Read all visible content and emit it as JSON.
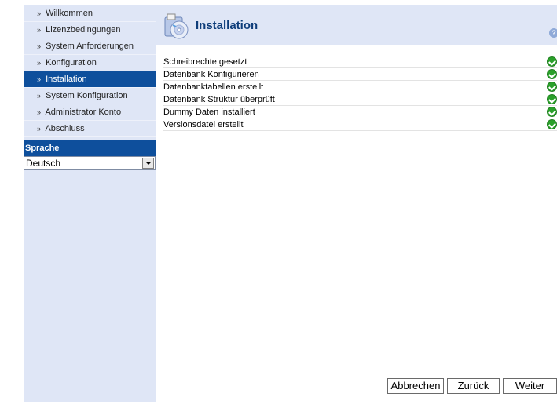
{
  "sidebar": {
    "items": [
      {
        "label": "Willkommen"
      },
      {
        "label": "Lizenzbedingungen"
      },
      {
        "label": "System Anforderungen"
      },
      {
        "label": "Konfiguration"
      },
      {
        "label": "Installation"
      },
      {
        "label": "System Konfiguration"
      },
      {
        "label": "Administrator Konto"
      },
      {
        "label": "Abschluss"
      }
    ],
    "arrow": "»",
    "language_header": "Sprache",
    "language_selected": "Deutsch"
  },
  "header": {
    "title": "Installation",
    "help": "?"
  },
  "steps": [
    {
      "label": "Schreibrechte gesetzt",
      "status": "ok"
    },
    {
      "label": "Datenbank Konfigurieren",
      "status": "ok"
    },
    {
      "label": "Datenbanktabellen erstellt",
      "status": "ok"
    },
    {
      "label": "Datenbank Struktur überprüft",
      "status": "ok"
    },
    {
      "label": "Dummy Daten installiert",
      "status": "ok"
    },
    {
      "label": "Versionsdatei erstellt",
      "status": "ok"
    }
  ],
  "buttons": {
    "cancel": "Abbrechen",
    "back": "Zurück",
    "next": "Weiter"
  },
  "colors": {
    "accent": "#0e4f9c",
    "sidebar_bg": "#dfe6f6",
    "ok_green": "#2aa02a"
  }
}
